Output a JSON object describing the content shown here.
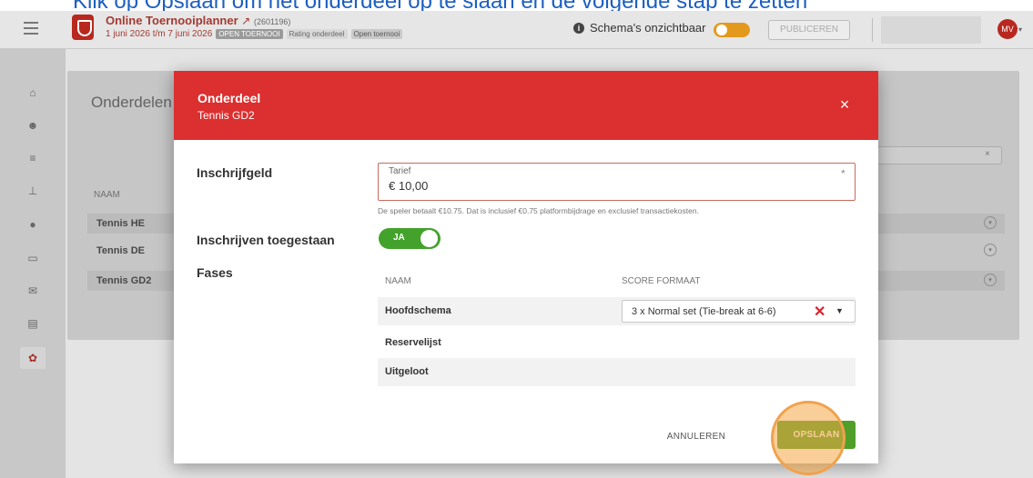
{
  "caption": {
    "text": "Klik op Opslaan om het onderdeel op te slaan en de volgende stap te zetten"
  },
  "topbar": {
    "app_title": "Online Toernooiplanner",
    "app_id": "(2601196)",
    "dates": "1 juni 2026 t/m 7 juni 2026",
    "badges": [
      "OPEN TOERNOOI",
      "Rating onderdeel",
      "Open toernooi"
    ],
    "schema_text": "Schema's onzichtbaar",
    "publish_label": "PUBLICEREN",
    "avatar_initials": "MV"
  },
  "background_page": {
    "heading": "Onderdelen",
    "column_header": "NAAM",
    "rows": [
      "Tennis HE",
      "Tennis DE",
      "Tennis GD2"
    ],
    "search_clear": "×"
  },
  "modal": {
    "title": "Onderdeel",
    "subtitle": "Tennis GD2",
    "close": "×",
    "fee_label": "Inschrijfgeld",
    "fee_field_label": "Tarief",
    "fee_value": "€ 10,00",
    "fee_required": "*",
    "fee_hint": "De speler betaalt €10.75. Dat is inclusief €0.75 platformbijdrage en exclusief transactiekosten.",
    "registration_label": "Inschrijven toegestaan",
    "registration_toggle": "JA",
    "phases_label": "Fases",
    "phases_headers": {
      "name": "NAAM",
      "score_format": "SCORE FORMAAT"
    },
    "phases": [
      {
        "name": "Hoofdschema",
        "score_format": "3 x Normal set (Tie-break at 6-6)"
      },
      {
        "name": "Reservelijst",
        "score_format": ""
      },
      {
        "name": "Uitgeloot",
        "score_format": ""
      }
    ],
    "clear_icon": "✕",
    "dropdown_icon": "▼",
    "cancel_label": "ANNULEREN",
    "save_label": "OPSLAAN"
  },
  "colors": {
    "header_red": "#dc2f2f",
    "save_green": "#4f9f2a",
    "toggle_green": "#43a22b",
    "highlight_orange": "#f0a24d"
  }
}
